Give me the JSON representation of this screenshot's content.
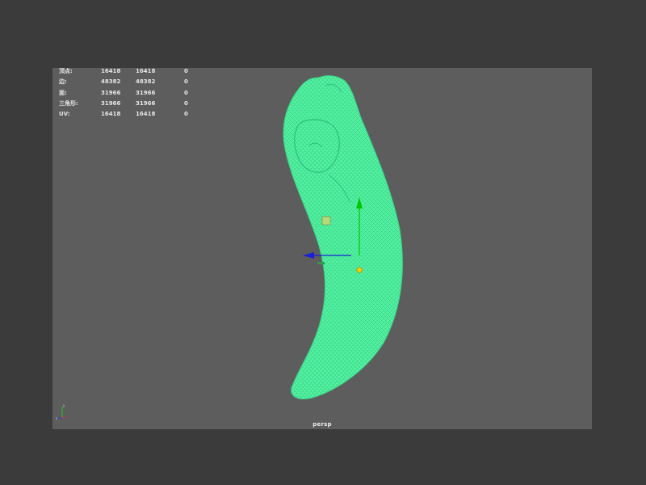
{
  "viewport": {
    "camera_name": "persp",
    "background": "#5d5d5d",
    "mesh_color": "#53f0a0",
    "wire_color": "#2dc27d"
  },
  "hud": {
    "rows": [
      {
        "label": "顶点:",
        "c1": "16418",
        "c2": "16418",
        "c3": "0"
      },
      {
        "label": "边:",
        "c1": "48382",
        "c2": "48382",
        "c3": "0"
      },
      {
        "label": "面:",
        "c1": "31966",
        "c2": "31966",
        "c3": "0"
      },
      {
        "label": "三角形:",
        "c1": "31966",
        "c2": "31966",
        "c3": "0"
      },
      {
        "label": "UV:",
        "c1": "16418",
        "c2": "16418",
        "c3": "0"
      }
    ]
  },
  "icons": {
    "manipulator": "move-tool-manipulator-icon",
    "axis_indicator": "view-axis-icon"
  }
}
